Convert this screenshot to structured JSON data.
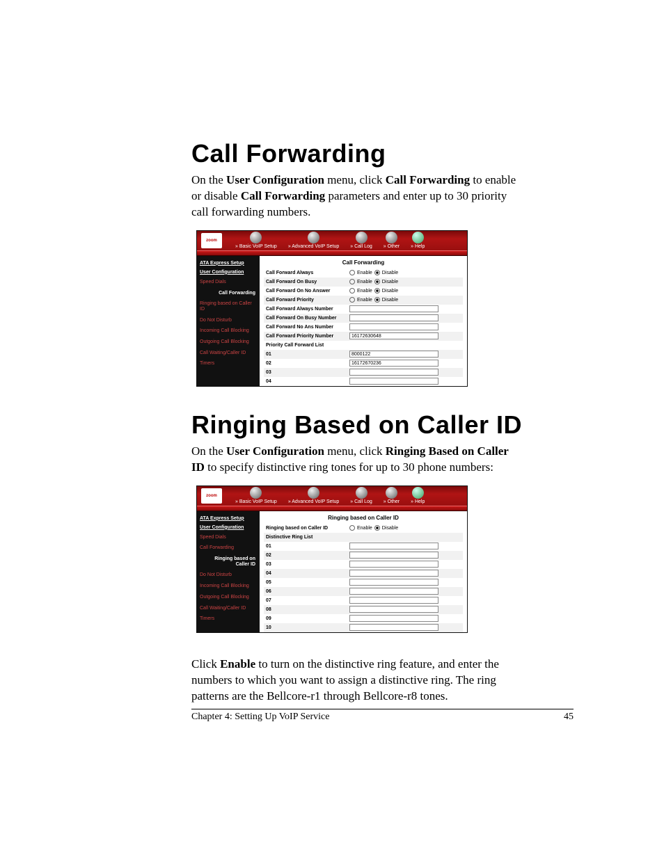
{
  "doc": {
    "h1a": "Call Forwarding",
    "p1_pre": "On the ",
    "p1_b1": "User Configuration",
    "p1_mid1": " menu, click ",
    "p1_b2": "Call Forwarding",
    "p1_mid2": " to enable or disable ",
    "p1_b3": "Call Forwarding",
    "p1_post": " parameters and enter up to 30 priority call forwarding numbers.",
    "h1b": "Ringing Based on Caller ID",
    "p2_pre": "On the ",
    "p2_b1": "User Configuration",
    "p2_mid1": " menu, click ",
    "p2_b2": "Ringing Based on Caller ID",
    "p2_post": " to specify distinctive ring tones for up to 30 phone numbers:",
    "p3_pre": "Click ",
    "p3_b1": "Enable",
    "p3_post": " to turn on the distinctive ring feature, and enter the numbers to which you want to assign a distinctive ring. The ring patterns are the Bellcore-r1 through Bellcore-r8 tones.",
    "footer_chapter": "Chapter 4: Setting Up VoIP Service",
    "footer_page": "45"
  },
  "ui": {
    "logo": "zoom",
    "tabs": [
      "» Basic VoIP Setup",
      "» Advanced VoIP Setup",
      "» Call Log",
      "» Other",
      "» Help"
    ],
    "side_hdr1": "ATA Express Setup",
    "side_hdr2": "User Configuration",
    "side_items": [
      "Speed Dials",
      "Call Forwarding",
      "Ringing based on Caller ID",
      "Do Not Disturb",
      "Incoming Call Blocking",
      "Outgoing Call Blocking",
      "Call Waiting/Caller ID",
      "Timers"
    ],
    "enable": "Enable",
    "disable": "Disable"
  },
  "shot1": {
    "title": "Call Forwarding",
    "active_side": "Call Forwarding",
    "radios": [
      {
        "lab": "Call Forward Always",
        "sel": "disable"
      },
      {
        "lab": "Call Forward On Busy",
        "sel": "disable"
      },
      {
        "lab": "Call Forward On No Answer",
        "sel": "disable"
      },
      {
        "lab": "Call Forward Priority",
        "sel": "disable"
      }
    ],
    "texts": [
      {
        "lab": "Call Forward Always Number",
        "val": ""
      },
      {
        "lab": "Call Forward On Busy Number",
        "val": ""
      },
      {
        "lab": "Call Forward No Ans Number",
        "val": ""
      },
      {
        "lab": "Call Forward Priority Number",
        "val": "16172630648"
      }
    ],
    "list_header": "Priority Call Forward List",
    "list": [
      {
        "n": "01",
        "val": "8000122"
      },
      {
        "n": "02",
        "val": "16172670236"
      },
      {
        "n": "03",
        "val": ""
      },
      {
        "n": "04",
        "val": ""
      }
    ]
  },
  "shot2": {
    "title": "Ringing based on Caller ID",
    "active_side": "Ringing based on Caller ID",
    "radios": [
      {
        "lab": "Ringing based on Caller ID",
        "sel": "disable"
      }
    ],
    "list_header": "Distinctive Ring List",
    "list": [
      {
        "n": "01",
        "val": ""
      },
      {
        "n": "02",
        "val": ""
      },
      {
        "n": "03",
        "val": ""
      },
      {
        "n": "04",
        "val": ""
      },
      {
        "n": "05",
        "val": ""
      },
      {
        "n": "06",
        "val": ""
      },
      {
        "n": "07",
        "val": ""
      },
      {
        "n": "08",
        "val": ""
      },
      {
        "n": "09",
        "val": ""
      },
      {
        "n": "10",
        "val": ""
      }
    ]
  }
}
